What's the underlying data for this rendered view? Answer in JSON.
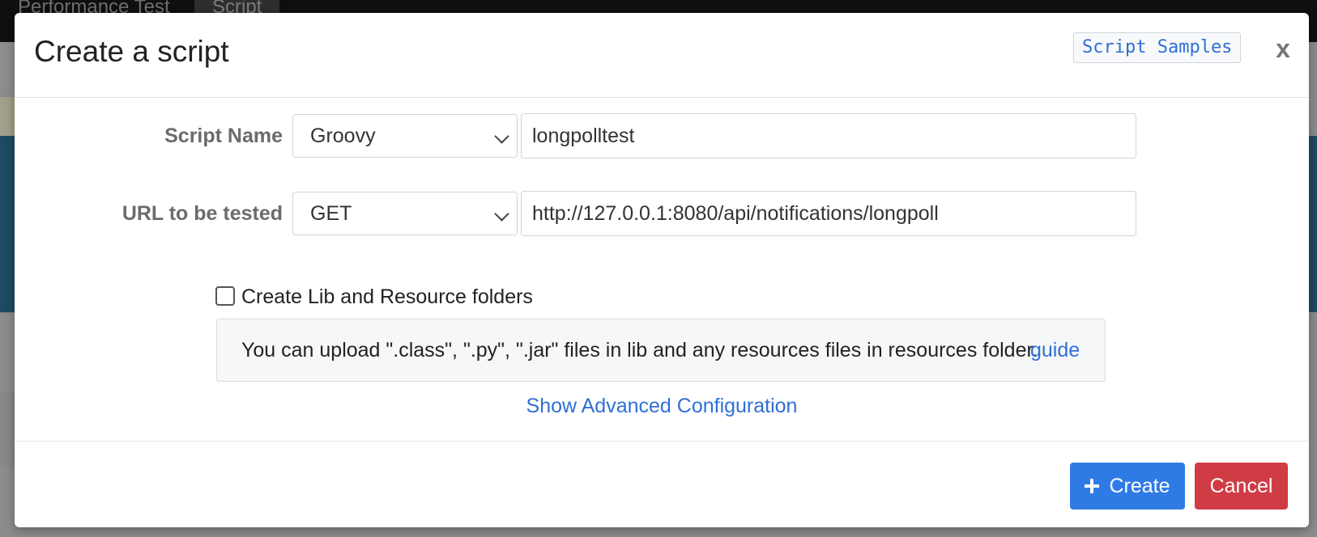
{
  "background": {
    "tabs": [
      "Performance Test",
      "Script"
    ]
  },
  "modal": {
    "title": "Create a script",
    "samples_button": "Script Samples",
    "close_label": "x",
    "script_name": {
      "label": "Script Name",
      "type_selected": "Groovy",
      "value": "longpolltest"
    },
    "url": {
      "label": "URL to be tested",
      "method_selected": "GET",
      "value": "http://127.0.0.1:8080/api/notifications/longpoll"
    },
    "lib_checkbox": {
      "label": "Create Lib and Resource folders",
      "checked": false
    },
    "info": {
      "text": "You can upload \".class\", \".py\", \".jar\" files in lib and any resources files in resources folder.",
      "link": "guide"
    },
    "advanced_link": "Show Advanced Configuration",
    "footer": {
      "create_label": "Create",
      "cancel_label": "Cancel"
    }
  },
  "colors": {
    "primary": "#2f7be6",
    "danger": "#cf3c44",
    "link": "#2f6fd6"
  }
}
